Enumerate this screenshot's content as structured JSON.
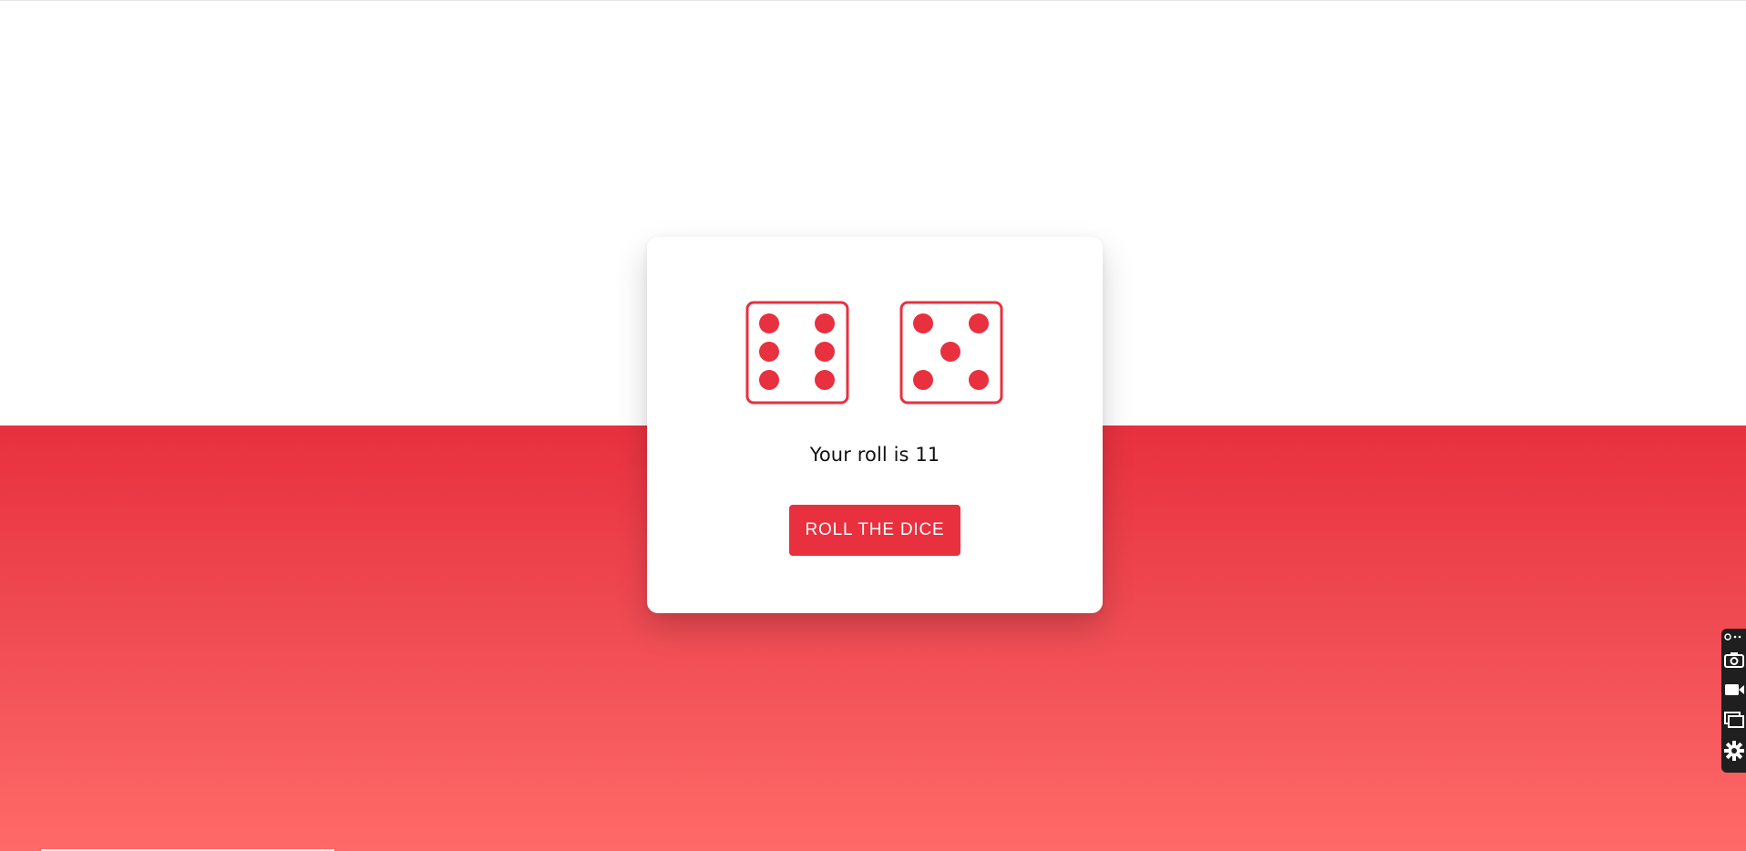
{
  "colors": {
    "accent": "#e8303f",
    "accent_light": "#ff6a68",
    "card_bg": "#ffffff",
    "text": "#111111"
  },
  "dice": [
    {
      "value": 6
    },
    {
      "value": 5
    }
  ],
  "result": {
    "text": "Your roll is 11"
  },
  "actions": {
    "roll_label": "ROLL THE DICE"
  },
  "side_toolbar": {
    "icons": [
      "link-icon",
      "camera-icon",
      "video-camera-icon",
      "window-icon",
      "gear-icon"
    ]
  }
}
